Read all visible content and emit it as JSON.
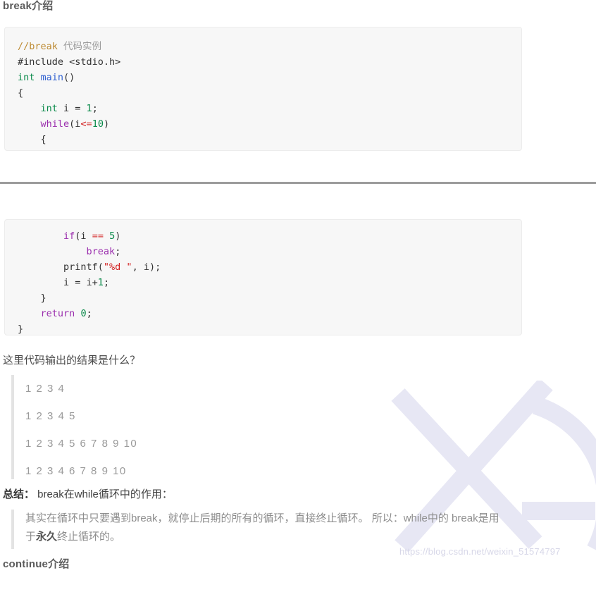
{
  "headings": {
    "break_intro": "break介绍",
    "continue_intro": "continue介绍"
  },
  "code_block_1": {
    "name": "break-example-code-top",
    "lines": [
      {
        "segments": [
          {
            "t": "//break ",
            "c": "comment"
          },
          {
            "t": "代码实例",
            "c": "comment-cn"
          }
        ]
      },
      {
        "segments": [
          {
            "t": "#include <stdio.h>",
            "c": "pre"
          }
        ]
      },
      {
        "segments": [
          {
            "t": "int ",
            "c": "type"
          },
          {
            "t": "main",
            "c": "fn"
          },
          {
            "t": "()",
            "c": "plain"
          }
        ]
      },
      {
        "segments": [
          {
            "t": "{",
            "c": "plain"
          }
        ]
      },
      {
        "segments": [
          {
            "t": "    int ",
            "c": "type"
          },
          {
            "t": "i = ",
            "c": "plain"
          },
          {
            "t": "1",
            "c": "num"
          },
          {
            "t": ";",
            "c": "plain"
          }
        ]
      },
      {
        "segments": [
          {
            "t": "    ",
            "c": "plain"
          },
          {
            "t": "while",
            "c": "kw"
          },
          {
            "t": "(i",
            "c": "plain"
          },
          {
            "t": "<=",
            "c": "op"
          },
          {
            "t": "10",
            "c": "num"
          },
          {
            "t": ")",
            "c": "plain"
          }
        ]
      },
      {
        "segments": [
          {
            "t": "    {",
            "c": "plain"
          }
        ]
      }
    ]
  },
  "code_block_2": {
    "name": "break-example-code-bottom",
    "lines": [
      {
        "segments": [
          {
            "t": "        ",
            "c": "plain"
          },
          {
            "t": "if",
            "c": "kw"
          },
          {
            "t": "(i ",
            "c": "plain"
          },
          {
            "t": "==",
            "c": "op"
          },
          {
            "t": " ",
            "c": "plain"
          },
          {
            "t": "5",
            "c": "num"
          },
          {
            "t": ")",
            "c": "plain"
          }
        ]
      },
      {
        "segments": [
          {
            "t": "            ",
            "c": "plain"
          },
          {
            "t": "break",
            "c": "kw"
          },
          {
            "t": ";",
            "c": "plain"
          }
        ]
      },
      {
        "segments": [
          {
            "t": "        printf(",
            "c": "plain"
          },
          {
            "t": "\"%d \"",
            "c": "str"
          },
          {
            "t": ", i);",
            "c": "plain"
          }
        ]
      },
      {
        "segments": [
          {
            "t": "        i = i+",
            "c": "plain"
          },
          {
            "t": "1",
            "c": "num"
          },
          {
            "t": ";",
            "c": "plain"
          }
        ]
      },
      {
        "segments": [
          {
            "t": "    }",
            "c": "plain"
          }
        ]
      },
      {
        "segments": [
          {
            "t": "    ",
            "c": "plain"
          },
          {
            "t": "return",
            "c": "kw"
          },
          {
            "t": " ",
            "c": "plain"
          },
          {
            "t": "0",
            "c": "num"
          },
          {
            "t": ";",
            "c": "plain"
          }
        ]
      },
      {
        "segments": [
          {
            "t": "}",
            "c": "plain"
          }
        ]
      }
    ]
  },
  "question": "这里代码输出的结果是什么？",
  "answers": [
    "1 2 3 4",
    "1 2 3 4 5",
    "1 2 3 4 5 6 7 8 9 10",
    "1 2 3 4 6 7 8 9 10"
  ],
  "summary": {
    "lead": "总结：",
    "title": " break在while循环中的作用：",
    "body_before": "其实在循环中只要遇到break，就停止后期的所有的循环，直接终止循环。 所以：while中的 break是用于",
    "body_emphasis": "永久",
    "body_after": "终止循环的。"
  },
  "watermark": {
    "url": "https://blog.csdn.net/weixin_51574797",
    "logo_color": "#e8e8f5",
    "url_color": "#d7d7e8"
  },
  "colors": {
    "code_bg": "#f7f7f7",
    "code_border": "#ececec",
    "divider": "#9c9c9c",
    "quote_bar": "#e3e3e3",
    "comment": "#bd8b33",
    "keyword": "#9b2fae",
    "type": "#0a8a4a",
    "number": "#0a8a4a",
    "string": "#d32020",
    "operator": "#d32020",
    "function": "#2e5fd0"
  }
}
